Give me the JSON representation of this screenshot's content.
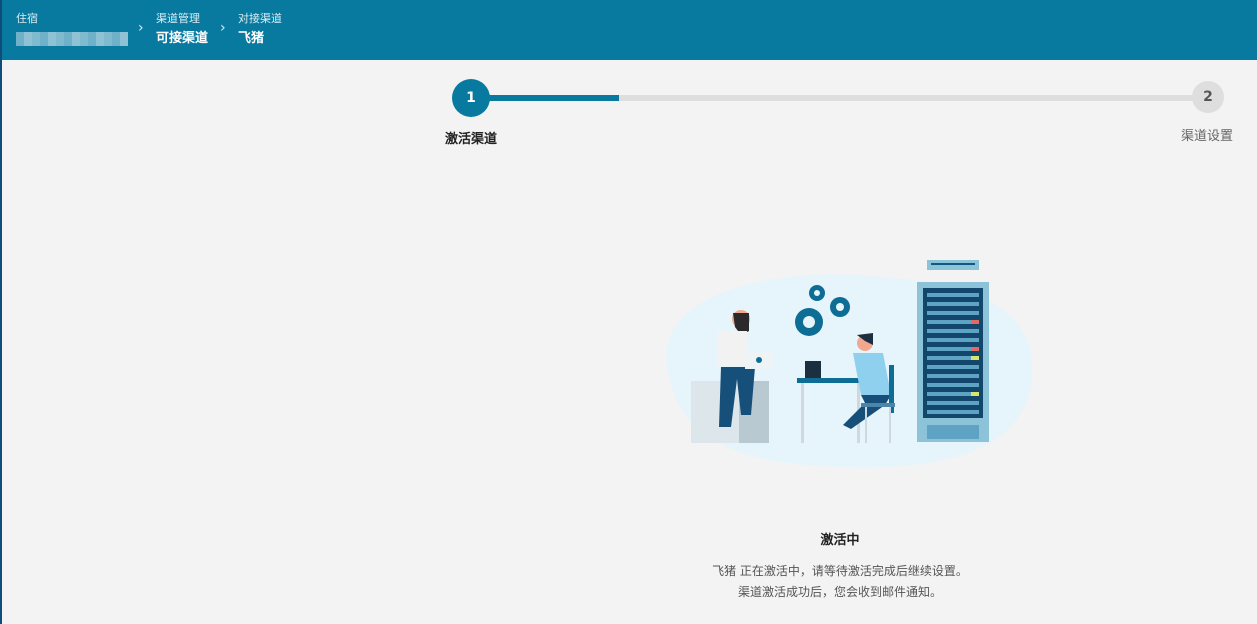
{
  "breadcrumb": [
    {
      "small": "住宿",
      "big": ""
    },
    {
      "small": "渠道管理",
      "big": "可接渠道"
    },
    {
      "small": "对接渠道",
      "big": "飞猪"
    }
  ],
  "steps": [
    {
      "number": "1",
      "label": "激活渠道",
      "state": "active"
    },
    {
      "number": "2",
      "label": "渠道设置",
      "state": "pending"
    }
  ],
  "progress": 0.2,
  "status": {
    "title": "激活中",
    "line1": "飞猪 正在激活中，请等待激活完成后继续设置。",
    "line2": "渠道激活成功后，您会收到邮件通知。"
  },
  "colors": {
    "primary": "#087aa0",
    "background": "#f3f3f3",
    "track": "#dedede"
  }
}
